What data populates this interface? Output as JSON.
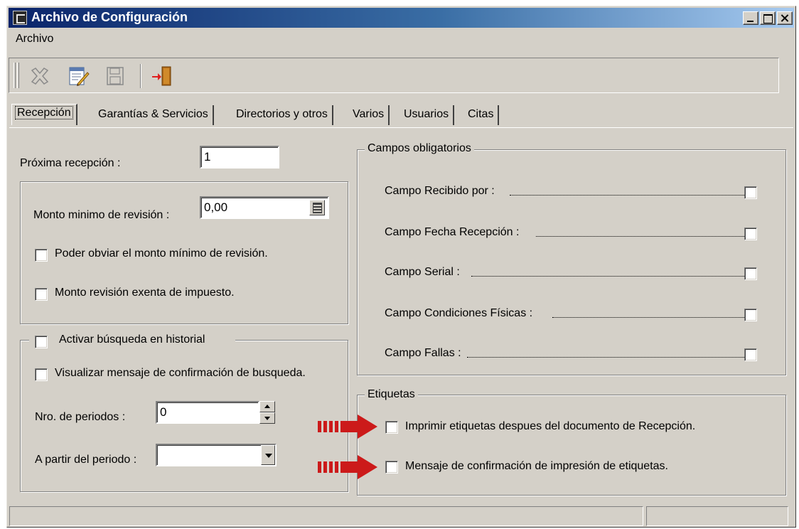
{
  "window": {
    "title": "Archivo de Configuración"
  },
  "menu": {
    "items": [
      "Archivo"
    ]
  },
  "toolbar": {
    "buttons": [
      {
        "name": "delete",
        "icon": "cross-icon"
      },
      {
        "name": "edit",
        "icon": "edit-document-icon"
      },
      {
        "name": "save",
        "icon": "save-disk-icon"
      },
      {
        "name": "exit",
        "icon": "exit-door-icon"
      }
    ]
  },
  "tabs": [
    "Recepción",
    "Garantías & Servicios",
    "Directorios y otros",
    "Varios",
    "Usuarios",
    "Citas"
  ],
  "recepcion": {
    "proxima_label": "Próxima recepción :",
    "proxima_value": "1",
    "monto_label": "Monto minimo de revisión :",
    "monto_value": "0,00",
    "obviar_label": "Poder obviar el monto mínimo de revisión.",
    "exenta_label": "Monto revisión exenta de impuesto.",
    "historial_label": "Activar búsqueda en historial",
    "visualizar_label": "Visualizar mensaje de confirmación de busqueda.",
    "nro_periodos_label": "Nro. de periodos  :",
    "nro_periodos_value": "0",
    "a_partir_label": "A partir del periodo :",
    "a_partir_value": ""
  },
  "campos": {
    "title": "Campos obligatorios",
    "items": [
      "Campo Recibido por :",
      "Campo Fecha Recepción :",
      "Campo Serial :",
      "Campo Condiciones Físicas :",
      "Campo Fallas :"
    ]
  },
  "etiquetas": {
    "title": "Etiquetas",
    "imprimir_label": "Imprimir etiquetas despues del documento de Recepción.",
    "mensaje_label": "Mensaje de confirmación de impresión de etiquetas."
  },
  "colors": {
    "titlebar_start": "#0a246a",
    "titlebar_end": "#a6caf0",
    "face": "#d4d0c8",
    "annotation_arrow": "#cc1a1a"
  }
}
